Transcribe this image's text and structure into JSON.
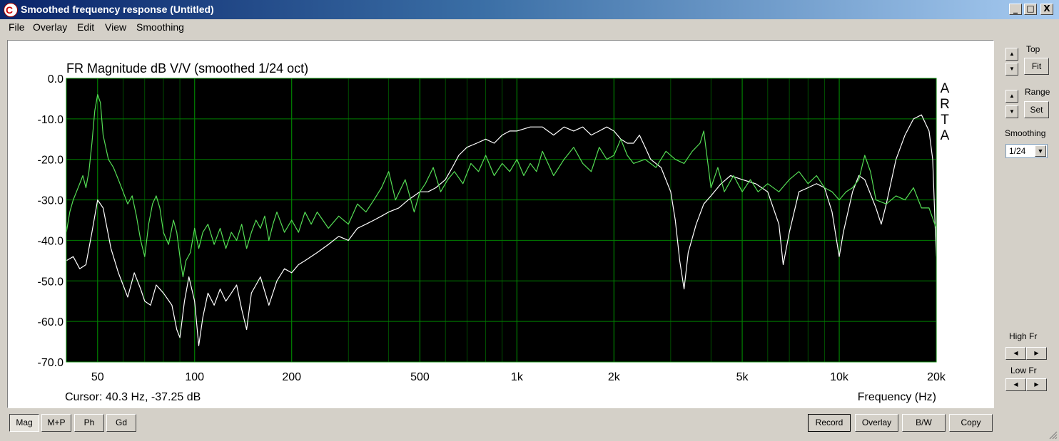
{
  "window": {
    "title": "Smoothed frequency response (Untitled)",
    "app_icon_letter": "C",
    "minimize_glyph": "_",
    "maximize_glyph": "□",
    "close_glyph": "X"
  },
  "menu": [
    "File",
    "Overlay",
    "Edit",
    "View",
    "Smoothing"
  ],
  "plot": {
    "title": "FR Magnitude dB V/V (smoothed 1/24 oct)",
    "brand_letters": [
      "A",
      "R",
      "T",
      "A"
    ],
    "cursor_readout": "Cursor: 40.3 Hz, -37.25 dB",
    "xlabel": "Frequency (Hz)",
    "colors": {
      "background": "#000000",
      "grid": "#008000",
      "trace_measured": "#ffffff",
      "trace_overlay": "#55dd55"
    }
  },
  "chart_data": {
    "type": "line",
    "xscale": "log",
    "xlim": [
      40,
      20000
    ],
    "ylim": [
      -70,
      0
    ],
    "x_ticks": [
      {
        "v": 50,
        "l": "50"
      },
      {
        "v": 100,
        "l": "100"
      },
      {
        "v": 200,
        "l": "200"
      },
      {
        "v": 500,
        "l": "500"
      },
      {
        "v": 1000,
        "l": "1k"
      },
      {
        "v": 2000,
        "l": "2k"
      },
      {
        "v": 5000,
        "l": "5k"
      },
      {
        "v": 10000,
        "l": "10k"
      },
      {
        "v": 20000,
        "l": "20k"
      }
    ],
    "y_ticks": [
      {
        "v": 0,
        "l": "0.0"
      },
      {
        "v": -10,
        "l": "-10.0"
      },
      {
        "v": -20,
        "l": "-20.0"
      },
      {
        "v": -30,
        "l": "-30.0"
      },
      {
        "v": -40,
        "l": "-40.0"
      },
      {
        "v": -50,
        "l": "-50.0"
      },
      {
        "v": -60,
        "l": "-60.0"
      },
      {
        "v": -70,
        "l": "-70.0"
      }
    ],
    "grid": true,
    "series": [
      {
        "color": "#ffffff",
        "points": [
          [
            40,
            -45
          ],
          [
            42,
            -44
          ],
          [
            44,
            -47
          ],
          [
            46,
            -46
          ],
          [
            48,
            -38
          ],
          [
            50,
            -30
          ],
          [
            52,
            -32
          ],
          [
            55,
            -42
          ],
          [
            58,
            -48
          ],
          [
            60,
            -51
          ],
          [
            62,
            -54
          ],
          [
            65,
            -48
          ],
          [
            68,
            -52
          ],
          [
            70,
            -55
          ],
          [
            73,
            -56
          ],
          [
            76,
            -51
          ],
          [
            80,
            -53
          ],
          [
            85,
            -56
          ],
          [
            88,
            -62
          ],
          [
            90,
            -64
          ],
          [
            93,
            -55
          ],
          [
            96,
            -49
          ],
          [
            100,
            -55
          ],
          [
            103,
            -66
          ],
          [
            106,
            -59
          ],
          [
            110,
            -53
          ],
          [
            115,
            -56
          ],
          [
            120,
            -52
          ],
          [
            125,
            -55
          ],
          [
            130,
            -53
          ],
          [
            135,
            -51
          ],
          [
            140,
            -57
          ],
          [
            145,
            -62
          ],
          [
            150,
            -53
          ],
          [
            155,
            -51
          ],
          [
            160,
            -49
          ],
          [
            170,
            -56
          ],
          [
            180,
            -50
          ],
          [
            190,
            -47
          ],
          [
            200,
            -48
          ],
          [
            210,
            -46
          ],
          [
            220,
            -45
          ],
          [
            240,
            -43
          ],
          [
            260,
            -41
          ],
          [
            280,
            -39
          ],
          [
            300,
            -40
          ],
          [
            320,
            -37
          ],
          [
            340,
            -36
          ],
          [
            360,
            -35
          ],
          [
            380,
            -34
          ],
          [
            400,
            -33
          ],
          [
            430,
            -32
          ],
          [
            460,
            -30
          ],
          [
            500,
            -28
          ],
          [
            530,
            -28
          ],
          [
            560,
            -27
          ],
          [
            600,
            -25
          ],
          [
            630,
            -22
          ],
          [
            660,
            -19
          ],
          [
            700,
            -17
          ],
          [
            750,
            -16
          ],
          [
            800,
            -15
          ],
          [
            850,
            -16
          ],
          [
            900,
            -14
          ],
          [
            950,
            -13
          ],
          [
            1000,
            -13
          ],
          [
            1100,
            -12
          ],
          [
            1200,
            -12
          ],
          [
            1300,
            -14
          ],
          [
            1400,
            -12
          ],
          [
            1500,
            -13
          ],
          [
            1600,
            -12
          ],
          [
            1700,
            -14
          ],
          [
            1800,
            -13
          ],
          [
            1900,
            -12
          ],
          [
            2000,
            -13
          ],
          [
            2100,
            -15
          ],
          [
            2200,
            -16
          ],
          [
            2300,
            -16
          ],
          [
            2400,
            -14
          ],
          [
            2500,
            -17
          ],
          [
            2600,
            -20
          ],
          [
            2800,
            -22
          ],
          [
            3000,
            -28
          ],
          [
            3100,
            -35
          ],
          [
            3200,
            -45
          ],
          [
            3300,
            -52
          ],
          [
            3400,
            -43
          ],
          [
            3600,
            -36
          ],
          [
            3800,
            -31
          ],
          [
            4000,
            -29
          ],
          [
            4300,
            -26
          ],
          [
            4600,
            -24
          ],
          [
            5000,
            -25
          ],
          [
            5500,
            -26
          ],
          [
            6000,
            -28
          ],
          [
            6500,
            -36
          ],
          [
            6700,
            -46
          ],
          [
            7000,
            -38
          ],
          [
            7500,
            -28
          ],
          [
            8000,
            -27
          ],
          [
            8500,
            -26
          ],
          [
            9000,
            -27
          ],
          [
            9500,
            -33
          ],
          [
            10000,
            -44
          ],
          [
            10300,
            -38
          ],
          [
            11000,
            -28
          ],
          [
            11500,
            -24
          ],
          [
            12000,
            -25
          ],
          [
            13000,
            -32
          ],
          [
            13500,
            -36
          ],
          [
            14000,
            -31
          ],
          [
            15000,
            -20
          ],
          [
            16000,
            -14
          ],
          [
            17000,
            -10
          ],
          [
            18000,
            -9
          ],
          [
            19000,
            -13
          ],
          [
            19500,
            -20
          ],
          [
            20000,
            -44
          ]
        ]
      },
      {
        "color": "#55dd55",
        "points": [
          [
            40,
            -38
          ],
          [
            41,
            -33
          ],
          [
            42,
            -30
          ],
          [
            44,
            -26
          ],
          [
            45,
            -24
          ],
          [
            46,
            -27
          ],
          [
            47,
            -23
          ],
          [
            48,
            -16
          ],
          [
            49,
            -8
          ],
          [
            50,
            -4
          ],
          [
            51,
            -6
          ],
          [
            52,
            -14
          ],
          [
            54,
            -20
          ],
          [
            56,
            -22
          ],
          [
            58,
            -25
          ],
          [
            60,
            -28
          ],
          [
            62,
            -31
          ],
          [
            64,
            -29
          ],
          [
            66,
            -34
          ],
          [
            68,
            -40
          ],
          [
            70,
            -44
          ],
          [
            72,
            -36
          ],
          [
            74,
            -31
          ],
          [
            76,
            -29
          ],
          [
            78,
            -32
          ],
          [
            80,
            -38
          ],
          [
            83,
            -41
          ],
          [
            86,
            -35
          ],
          [
            88,
            -38
          ],
          [
            90,
            -44
          ],
          [
            92,
            -49
          ],
          [
            94,
            -45
          ],
          [
            97,
            -43
          ],
          [
            100,
            -37
          ],
          [
            103,
            -42
          ],
          [
            106,
            -38
          ],
          [
            110,
            -36
          ],
          [
            115,
            -41
          ],
          [
            120,
            -37
          ],
          [
            125,
            -42
          ],
          [
            130,
            -38
          ],
          [
            135,
            -40
          ],
          [
            140,
            -36
          ],
          [
            145,
            -42
          ],
          [
            150,
            -38
          ],
          [
            155,
            -35
          ],
          [
            160,
            -37
          ],
          [
            165,
            -34
          ],
          [
            170,
            -40
          ],
          [
            175,
            -36
          ],
          [
            180,
            -33
          ],
          [
            190,
            -38
          ],
          [
            200,
            -35
          ],
          [
            210,
            -38
          ],
          [
            220,
            -33
          ],
          [
            230,
            -36
          ],
          [
            240,
            -33
          ],
          [
            260,
            -37
          ],
          [
            280,
            -34
          ],
          [
            300,
            -36
          ],
          [
            320,
            -31
          ],
          [
            340,
            -33
          ],
          [
            360,
            -30
          ],
          [
            380,
            -27
          ],
          [
            400,
            -23
          ],
          [
            420,
            -30
          ],
          [
            450,
            -25
          ],
          [
            480,
            -33
          ],
          [
            500,
            -28
          ],
          [
            520,
            -26
          ],
          [
            550,
            -22
          ],
          [
            580,
            -28
          ],
          [
            610,
            -25
          ],
          [
            640,
            -23
          ],
          [
            680,
            -26
          ],
          [
            720,
            -21
          ],
          [
            760,
            -23
          ],
          [
            800,
            -19
          ],
          [
            850,
            -24
          ],
          [
            900,
            -21
          ],
          [
            950,
            -23
          ],
          [
            1000,
            -20
          ],
          [
            1050,
            -24
          ],
          [
            1100,
            -21
          ],
          [
            1150,
            -23
          ],
          [
            1200,
            -18
          ],
          [
            1300,
            -24
          ],
          [
            1400,
            -20
          ],
          [
            1500,
            -17
          ],
          [
            1600,
            -21
          ],
          [
            1700,
            -23
          ],
          [
            1800,
            -17
          ],
          [
            1900,
            -20
          ],
          [
            2000,
            -19
          ],
          [
            2100,
            -15
          ],
          [
            2200,
            -19
          ],
          [
            2300,
            -21
          ],
          [
            2500,
            -20
          ],
          [
            2700,
            -22
          ],
          [
            2900,
            -18
          ],
          [
            3100,
            -20
          ],
          [
            3300,
            -21
          ],
          [
            3500,
            -18
          ],
          [
            3700,
            -16
          ],
          [
            3800,
            -13
          ],
          [
            4000,
            -27
          ],
          [
            4200,
            -22
          ],
          [
            4400,
            -28
          ],
          [
            4700,
            -24
          ],
          [
            5000,
            -28
          ],
          [
            5300,
            -25
          ],
          [
            5600,
            -28
          ],
          [
            6000,
            -26
          ],
          [
            6500,
            -28
          ],
          [
            7000,
            -25
          ],
          [
            7500,
            -23
          ],
          [
            8000,
            -26
          ],
          [
            8500,
            -24
          ],
          [
            9000,
            -27
          ],
          [
            9500,
            -28
          ],
          [
            10000,
            -30
          ],
          [
            10500,
            -28
          ],
          [
            11000,
            -27
          ],
          [
            11500,
            -25
          ],
          [
            12000,
            -19
          ],
          [
            12500,
            -23
          ],
          [
            13000,
            -30
          ],
          [
            14000,
            -31
          ],
          [
            15000,
            -29
          ],
          [
            16000,
            -30
          ],
          [
            17000,
            -27
          ],
          [
            18000,
            -32
          ],
          [
            19000,
            -32
          ],
          [
            20000,
            -37
          ]
        ]
      }
    ]
  },
  "sidebar": {
    "top_label": "Top",
    "fit_label": "Fit",
    "range_label": "Range",
    "set_label": "Set",
    "smoothing_label": "Smoothing",
    "smoothing_value": "1/24",
    "high_fr_label": "High Fr",
    "low_fr_label": "Low Fr",
    "up_glyph": "▲",
    "down_glyph": "▼",
    "left_glyph": "◀",
    "right_glyph": "▶",
    "dropdown_glyph": "▼"
  },
  "bottom_left_buttons": [
    "Mag",
    "M+P",
    "Ph",
    "Gd"
  ],
  "bottom_right_buttons": [
    "Record",
    "Overlay",
    "B/W",
    "Copy"
  ]
}
